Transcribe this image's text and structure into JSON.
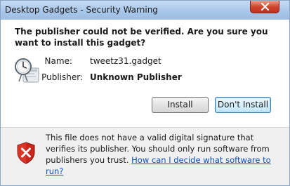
{
  "window": {
    "title": "Desktop Gadgets - Security Warning"
  },
  "heading": "The publisher could not be verified. Are you sure you want to install this gadget?",
  "fields": {
    "name_label": "Name:",
    "name_value": "tweetz31.gadget",
    "publisher_label": "Publisher:",
    "publisher_value": "Unknown Publisher"
  },
  "buttons": {
    "install": "Install",
    "dont_install": "Don't Install"
  },
  "footer": {
    "text": "This file does not have a valid digital signature that verifies its publisher. You should only run software from publishers you trust.",
    "link": "How can I decide what software to run?"
  },
  "icons": {
    "close": "close-icon",
    "gadget": "gadget-clock-icon",
    "warning": "shield-warning-icon"
  },
  "colors": {
    "link": "#0b4fb8",
    "shield_red": "#c8261b"
  }
}
